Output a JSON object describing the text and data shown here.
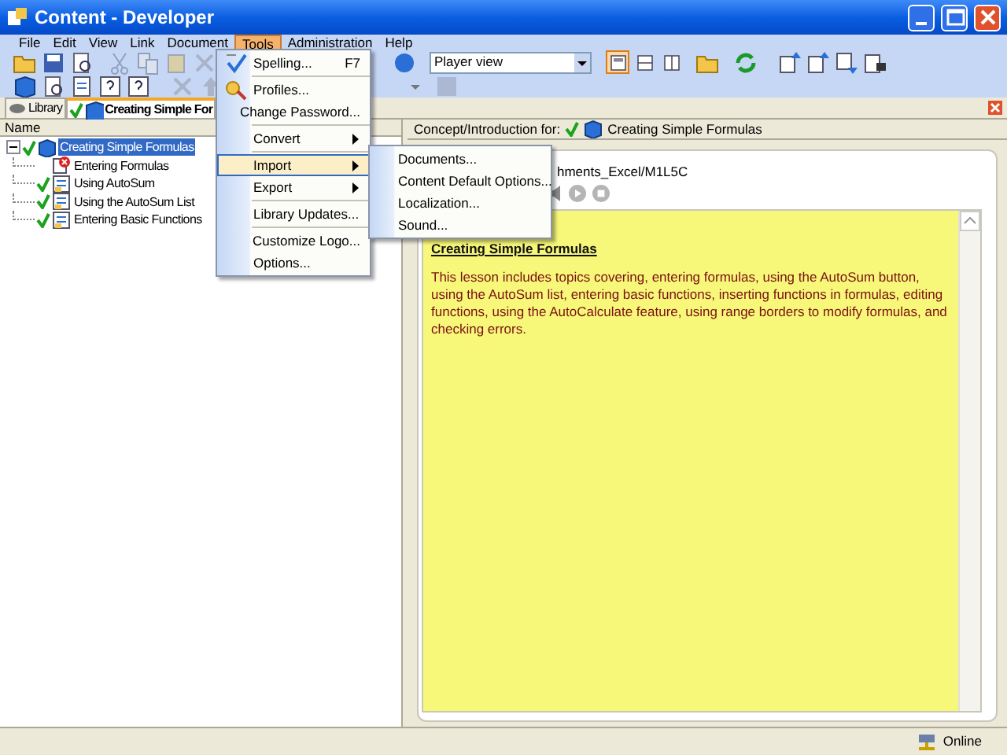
{
  "window": {
    "title": "Content - Developer"
  },
  "menu_bar": [
    {
      "label": "File",
      "selected": false
    },
    {
      "label": "Edit",
      "selected": false
    },
    {
      "label": "View",
      "selected": false
    },
    {
      "label": "Link",
      "selected": false
    },
    {
      "label": "Document",
      "selected": false
    },
    {
      "label": "Tools",
      "selected": true
    },
    {
      "label": "Administration",
      "selected": false
    },
    {
      "label": "Help",
      "selected": false
    }
  ],
  "toolbar": {
    "view_select": {
      "value": "Player view"
    },
    "view_buttons": [
      {
        "selected": true
      },
      {
        "selected": false
      },
      {
        "selected": false
      }
    ]
  },
  "tabs": [
    {
      "label": "Library",
      "selected": false
    },
    {
      "label": "Creating Simple For",
      "selected": true
    }
  ],
  "tree": {
    "header": "Name",
    "items": [
      {
        "label": "Creating Simple Formulas",
        "kind": "book",
        "checked": true,
        "selected": true,
        "expanded": true,
        "children": [
          {
            "label": "Entering Formulas",
            "kind": "error",
            "checked": false,
            "selected": false
          },
          {
            "label": "Using AutoSum",
            "kind": "topic",
            "checked": true,
            "selected": false
          },
          {
            "label": "Using the AutoSum List",
            "kind": "topic",
            "checked": true,
            "selected": false
          },
          {
            "label": "Entering Basic Functions",
            "kind": "topic",
            "checked": true,
            "selected": false
          }
        ]
      }
    ]
  },
  "detail": {
    "header_label": "Concept/Introduction for:",
    "header_checked": true,
    "header_title": "Creating Simple Formulas",
    "path": "hments_Excel/M1L5C",
    "heading": "Creating Simple Formulas",
    "body": "This lesson includes topics covering, entering formulas, using the AutoSum button, using the AutoSum list, entering basic functions, inserting functions in formulas, editing functions, using the AutoCalculate feature, using range borders to modify formulas, and checking errors."
  },
  "tools_menu": {
    "items": [
      {
        "kind": "item",
        "label": "Spelling...",
        "shortcut": "F7",
        "selected": false
      },
      {
        "kind": "separator"
      },
      {
        "kind": "item",
        "label": "Profiles...",
        "selected": false
      },
      {
        "kind": "item",
        "label": "Change Password...",
        "selected": false
      },
      {
        "kind": "separator"
      },
      {
        "kind": "submenu",
        "label": "Convert",
        "selected": false
      },
      {
        "kind": "separator"
      },
      {
        "kind": "submenu",
        "label": "Import",
        "selected": true,
        "items": [
          {
            "label": "Documents...",
            "selected": false
          },
          {
            "label": "Content Default Options...",
            "selected": false
          },
          {
            "label": "Localization...",
            "selected": false
          },
          {
            "label": "Sound...",
            "selected": false
          }
        ]
      },
      {
        "kind": "submenu",
        "label": "Export",
        "selected": false
      },
      {
        "kind": "separator"
      },
      {
        "kind": "item",
        "label": "Library Updates...",
        "selected": false
      },
      {
        "kind": "separator"
      },
      {
        "kind": "item",
        "label": "Customize Logo...",
        "selected": false
      },
      {
        "kind": "item",
        "label": "Options...",
        "selected": false
      }
    ]
  },
  "status_bar": {
    "status": "Online"
  }
}
